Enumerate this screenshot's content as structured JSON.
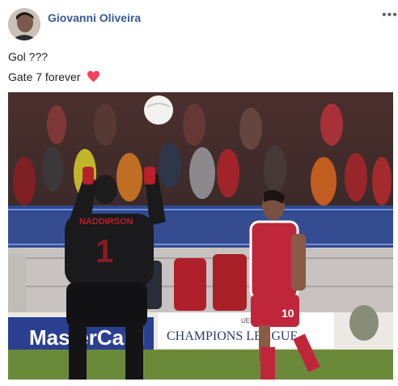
{
  "post": {
    "author": "Giovanni Oliveira",
    "text_line1": "Gol ???",
    "text_line2": "Gate 7 forever",
    "more_icon": "more-horizontal-icon",
    "emoji": "heart-icon",
    "emoji_color": "#f3425f"
  },
  "photo": {
    "keeper_shirt_text": "NADDIRSON",
    "keeper_number": "1",
    "player_number": "10",
    "board_sponsor": "MasterCard",
    "board_competition": "CHAMPIONS LEAGUE",
    "board_uefa": "UEFA"
  }
}
